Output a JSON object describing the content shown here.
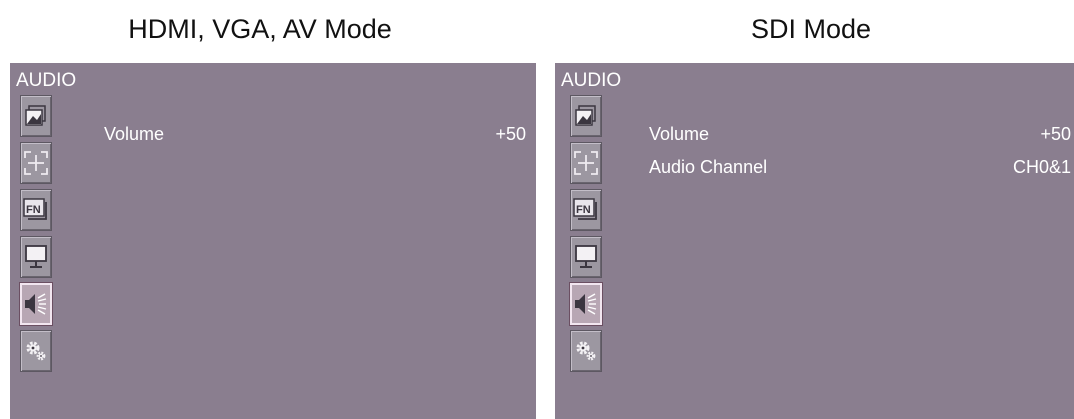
{
  "titles": {
    "left": "HDMI, VGA, AV Mode",
    "right": "SDI Mode"
  },
  "panels": {
    "left": {
      "header": "AUDIO",
      "items": [
        {
          "label": "Volume",
          "value": "+50"
        }
      ]
    },
    "right": {
      "header": "AUDIO",
      "items": [
        {
          "label": "Volume",
          "value": "+50"
        },
        {
          "label": "Audio Channel",
          "value": "CH0&1"
        }
      ]
    }
  },
  "sidebar_icons": [
    "picture-icon",
    "crosshair-icon",
    "fn-icon",
    "monitor-icon",
    "speaker-icon",
    "gear-icon"
  ],
  "selected_icon": "speaker-icon",
  "colors": {
    "panel_background": "#8a7e8f",
    "text": "#ffffff",
    "icon_background": "#9c97a1",
    "icon_selected_background": "#b8a7b4"
  }
}
